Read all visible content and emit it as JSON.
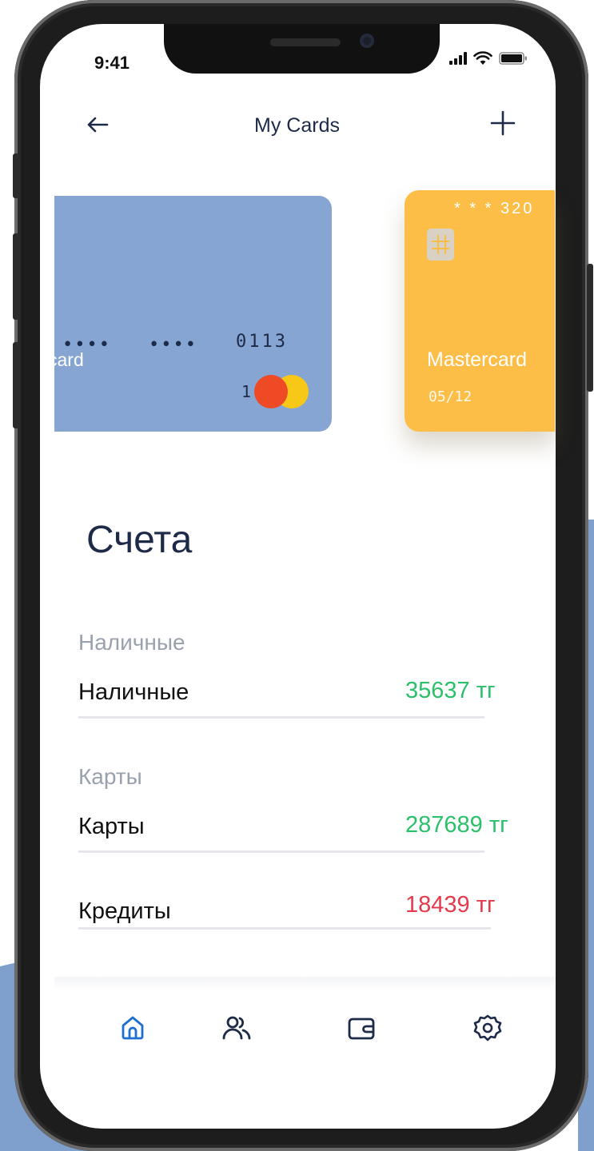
{
  "status_bar": {
    "time": "9:41"
  },
  "header": {
    "back_icon": "arrow-left-icon",
    "title": "My Cards",
    "add_icon": "plus-icon"
  },
  "cards": [
    {
      "dots_1": "••••",
      "dots_2": "••••",
      "last_digits": "0113",
      "brand_partial": "card",
      "expiry_partial": "1",
      "color": "#87a5d2"
    },
    {
      "number_partial": "* * *  320",
      "brand": "Mastercard",
      "expiry": "05/12",
      "color": "#fdbe48"
    }
  ],
  "accounts": {
    "title": "Счета",
    "groups": [
      {
        "heading": "Наличные",
        "label": "Наличные",
        "amount": "35637 тг",
        "status": "positive"
      },
      {
        "heading": "Карты",
        "label": "Карты",
        "amount": "287689 тг",
        "status": "positive"
      },
      {
        "heading": "",
        "label": "Кредиты",
        "amount": "18439 тг",
        "status": "negative"
      }
    ]
  },
  "tabbar": {
    "items": [
      {
        "icon": "home-icon",
        "active": true
      },
      {
        "icon": "users-icon",
        "active": false
      },
      {
        "icon": "wallet-icon",
        "active": false
      },
      {
        "icon": "settings-icon",
        "active": false
      }
    ]
  },
  "colors": {
    "accent": "#1d6fd1",
    "text": "#1d2a48",
    "positive": "#2bc06a",
    "negative": "#e53a4c",
    "background_accent": "#7f9fcc"
  }
}
